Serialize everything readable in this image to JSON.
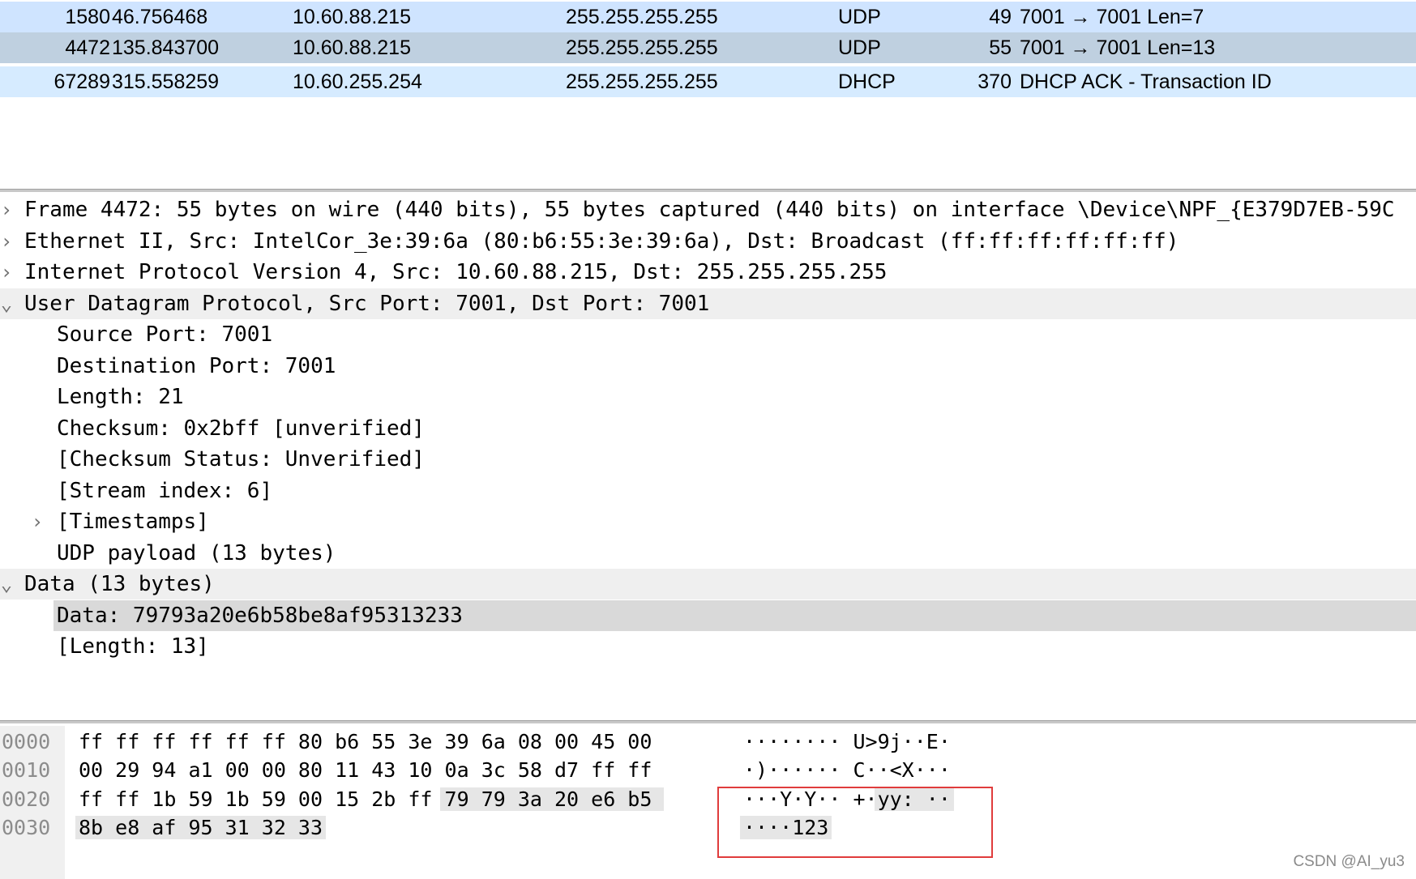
{
  "packet_list": {
    "rows": [
      {
        "no": "1580",
        "time": "46.756468",
        "source": "10.60.88.215",
        "destination": "255.255.255.255",
        "protocol": "UDP",
        "length": "49",
        "info": "7001 → 7001 Len=7",
        "bg": "#cfe4ff"
      },
      {
        "no": "4472",
        "time": "135.843700",
        "source": "10.60.88.215",
        "destination": "255.255.255.255",
        "protocol": "UDP",
        "length": "55",
        "info": "7001 → 7001 Len=13",
        "bg": "#bfd0e0"
      },
      {
        "no": "67289",
        "time": "315.558259",
        "source": "10.60.255.254",
        "destination": "255.255.255.255",
        "protocol": "DHCP",
        "length": "370",
        "info": "DHCP ACK       - Transaction ID",
        "bg": "#d6ebff"
      }
    ]
  },
  "details": {
    "rows": [
      {
        "arrow": "›",
        "text": "Frame 4472: 55 bytes on wire (440 bits), 55 bytes captured (440 bits) on interface \\Device\\NPF_{E379D7EB-59C",
        "indent": 0
      },
      {
        "arrow": "›",
        "text": "Ethernet II, Src: IntelCor_3e:39:6a (80:b6:55:3e:39:6a), Dst: Broadcast (ff:ff:ff:ff:ff:ff)",
        "indent": 0
      },
      {
        "arrow": "›",
        "text": "Internet Protocol Version 4, Src: 10.60.88.215, Dst: 255.255.255.255",
        "indent": 0
      },
      {
        "arrow": "⌄",
        "text": "User Datagram Protocol, Src Port: 7001, Dst Port: 7001",
        "indent": 0,
        "bg": "#efefef"
      },
      {
        "arrow": "",
        "text": "Source Port: 7001",
        "indent": 1
      },
      {
        "arrow": "",
        "text": "Destination Port: 7001",
        "indent": 1
      },
      {
        "arrow": "",
        "text": "Length: 21",
        "indent": 1
      },
      {
        "arrow": "",
        "text": "Checksum: 0x2bff [unverified]",
        "indent": 1
      },
      {
        "arrow": "",
        "text": "[Checksum Status: Unverified]",
        "indent": 1
      },
      {
        "arrow": "",
        "text": "[Stream index: 6]",
        "indent": 1
      },
      {
        "arrow": "›",
        "text": "[Timestamps]",
        "indent": 1
      },
      {
        "arrow": "",
        "text": "UDP payload (13 bytes)",
        "indent": 1
      },
      {
        "arrow": "⌄",
        "text": "Data (13 bytes)",
        "indent": 0,
        "bg": "#efefef"
      },
      {
        "arrow": "",
        "text": "Data: 79793a20e6b58be8af95313233",
        "indent": 1,
        "selected": true
      },
      {
        "arrow": "",
        "text": "[Length: 13]",
        "indent": 1
      }
    ]
  },
  "bytes": {
    "lines": [
      {
        "offset": "0000",
        "hex": "ff ff ff ff ff ff 80 b6  55 3e 39 6a 08 00 45 00",
        "ascii": "········ U>9j··E·"
      },
      {
        "offset": "0010",
        "hex": "00 29 94 a1 00 00 80 11  43 10 0a 3c 58 d7 ff ff",
        "ascii": "·)······ C··<X···"
      },
      {
        "offset": "0020",
        "hex": "ff ff 1b 59 1b 59 00 15  2b ff 79 79 3a 20 e6 b5",
        "ascii": "···Y·Y·· +·yy: ··"
      },
      {
        "offset": "0030",
        "hex": "8b e8 af 95 31 32 33",
        "ascii": "····123"
      }
    ]
  },
  "watermark": "CSDN @AI_yu3"
}
